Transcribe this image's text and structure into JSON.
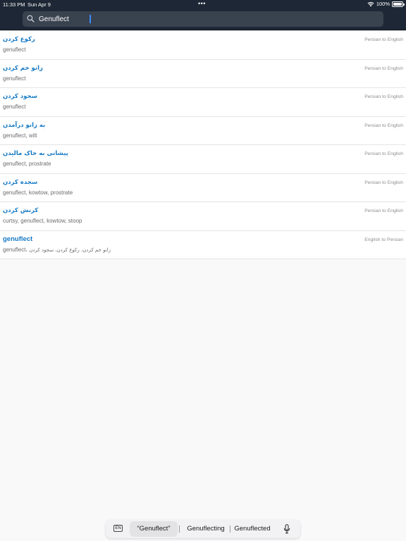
{
  "status": {
    "time": "11:33 PM",
    "date": "Sun Apr 9",
    "dots": "•••",
    "battery": "100%"
  },
  "search": {
    "query": "Genuflect"
  },
  "results": [
    {
      "title": "رکوع کردن",
      "subtitle": "genuflect",
      "direction": "Persian to English"
    },
    {
      "title": "زانو خم کردن",
      "subtitle": "genuflect",
      "direction": "Persian to English"
    },
    {
      "title": "سجود کردن",
      "subtitle": "genuflect",
      "direction": "Persian to English"
    },
    {
      "title": "به زانو درآمدن",
      "subtitle": "genuflect, wilt",
      "direction": "Persian to English"
    },
    {
      "title": "پیشانی به خاک مالیدن",
      "subtitle": "genuflect, prostrate",
      "direction": "Persian to English"
    },
    {
      "title": "سجده کردن",
      "subtitle": "genuflect, kowtow, prostrate",
      "direction": "Persian to English"
    },
    {
      "title": "کرنش کردن",
      "subtitle": "curtsy, genuflect, kowtow, stoop",
      "direction": "Persian to English"
    },
    {
      "title": "genuflect",
      "subtitle_prefix": "genuflect، ",
      "subtitle_fa": "زانو خم کردن، رکوع کردن، سجود کردن",
      "direction": "English to Persian"
    }
  ],
  "keyboard": {
    "lang": "EN",
    "suggestions": [
      "“Genuflect”",
      "Genuflecting",
      "Genuflected"
    ]
  }
}
